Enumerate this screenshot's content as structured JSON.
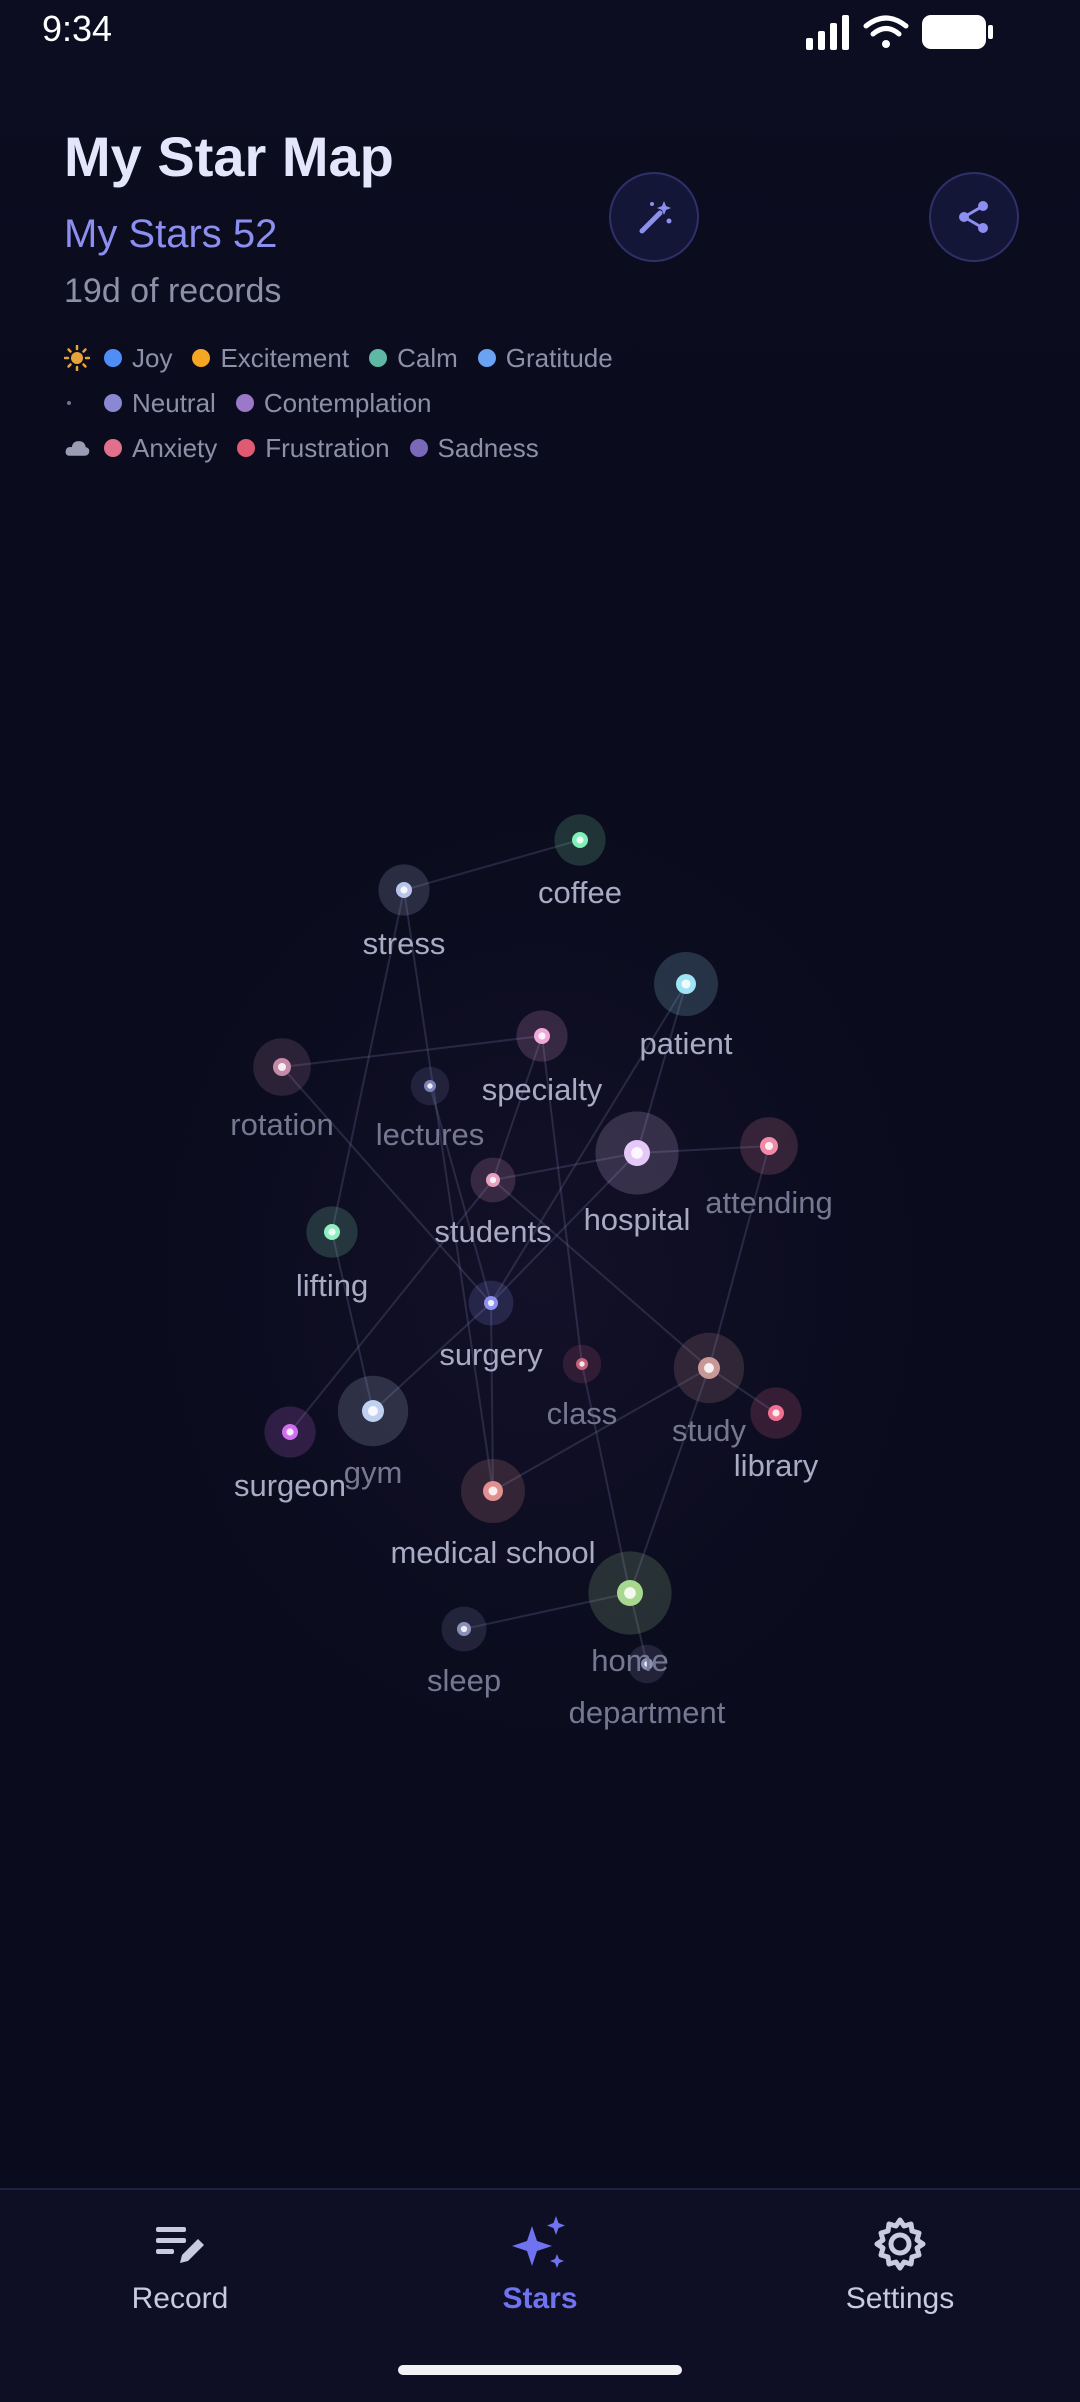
{
  "status_bar": {
    "time": "9:34"
  },
  "header": {
    "title": "My Star Map",
    "stars_count": "My Stars 52",
    "days_recorded": "19d of records"
  },
  "actions": {
    "magic_button_icon": "magic-wand-icon",
    "share_button_icon": "share-icon"
  },
  "legend": {
    "rows": [
      {
        "lead_icon": "sun-icon",
        "items": [
          {
            "label": "Joy",
            "color": "#4f8ef7"
          },
          {
            "label": "Excitement",
            "color": "#f5a623"
          },
          {
            "label": "Calm",
            "color": "#5fb8a4"
          },
          {
            "label": "Gratitude",
            "color": "#6aa2f4"
          }
        ]
      },
      {
        "lead_icon": "dot-icon",
        "items": [
          {
            "label": "Neutral",
            "color": "#8a88d4"
          },
          {
            "label": "Contemplation",
            "color": "#9b78c8"
          }
        ]
      },
      {
        "lead_icon": "cloud-icon",
        "items": [
          {
            "label": "Anxiety",
            "color": "#e0708c"
          },
          {
            "label": "Frustration",
            "color": "#e05a72"
          },
          {
            "label": "Sadness",
            "color": "#7a68b8"
          }
        ]
      }
    ]
  },
  "stars": [
    {
      "word": "coffee",
      "color": "#7ef0b8"
    },
    {
      "word": "stress",
      "color": "#b8c4e8"
    },
    {
      "word": "patient",
      "color": "#9fe4f4"
    },
    {
      "word": "specialty",
      "color": "#f0a8d8"
    },
    {
      "word": "rotation",
      "color": "#c48aa8"
    },
    {
      "word": "lectures",
      "color": "#7a82b8"
    },
    {
      "word": "hospital",
      "color": "#e6c8f8"
    },
    {
      "word": "attending",
      "color": "#f08aa8"
    },
    {
      "word": "students",
      "color": "#e8a0c0"
    },
    {
      "word": "lifting",
      "color": "#8ef0c0"
    },
    {
      "word": "surgery",
      "color": "#8c90f0"
    },
    {
      "word": "class",
      "color": "#c0607a"
    },
    {
      "word": "study",
      "color": "#c89898"
    },
    {
      "word": "library",
      "color": "#f07090"
    },
    {
      "word": "gym",
      "color": "#c0d0f0"
    },
    {
      "word": "surgeon",
      "color": "#d070f0"
    },
    {
      "word": "medical school",
      "color": "#e09090"
    },
    {
      "word": "home",
      "color": "#a8d890"
    },
    {
      "word": "sleep",
      "color": "#8890b8"
    },
    {
      "word": "department",
      "color": "#8890b8"
    }
  ],
  "connections": [
    [
      "stress",
      "lifting"
    ],
    [
      "stress",
      "medical school"
    ],
    [
      "stress",
      "coffee"
    ],
    [
      "rotation",
      "specialty"
    ],
    [
      "rotation",
      "surgery"
    ],
    [
      "specialty",
      "class"
    ],
    [
      "specialty",
      "students"
    ],
    [
      "patient",
      "hospital"
    ],
    [
      "patient",
      "surgery"
    ],
    [
      "hospital",
      "students"
    ],
    [
      "hospital",
      "attending"
    ],
    [
      "hospital",
      "surgery"
    ],
    [
      "attending",
      "study"
    ],
    [
      "lifting",
      "gym"
    ],
    [
      "gym",
      "surgery"
    ],
    [
      "surgeon",
      "students"
    ],
    [
      "surgery",
      "medical school"
    ],
    [
      "study",
      "medical school"
    ],
    [
      "study",
      "home"
    ],
    [
      "study",
      "library"
    ],
    [
      "home",
      "sleep"
    ],
    [
      "home",
      "department"
    ],
    [
      "lectures",
      "surgery"
    ],
    [
      "class",
      "home"
    ],
    [
      "students",
      "study"
    ]
  ],
  "bottom_nav": {
    "items": [
      {
        "label": "Record",
        "icon": "record-edit-icon"
      },
      {
        "label": "Stars",
        "icon": "sparkles-icon"
      },
      {
        "label": "Settings",
        "icon": "gear-icon"
      }
    ],
    "active": "Stars"
  }
}
